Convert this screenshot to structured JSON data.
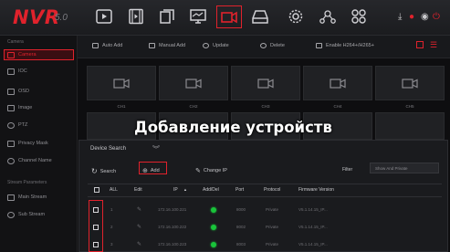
{
  "app": {
    "logo": "NVR",
    "version": "5.0"
  },
  "nav": {
    "icons": [
      "playback-icon",
      "film-icon",
      "files-icon",
      "monitor-icon",
      "camera-icon",
      "storage-icon",
      "gear-icon",
      "network-icon",
      "apps-icon"
    ],
    "active": "camera-icon",
    "right_icons": [
      "download-icon",
      "notification-icon",
      "user-icon",
      "power-icon"
    ]
  },
  "sidebar": {
    "section1": "Camera",
    "items1": [
      {
        "label": "Camera",
        "icon": "camera-icon",
        "selected": true
      },
      {
        "label": "IOC",
        "icon": "ioc-icon"
      },
      {
        "label": "OSD",
        "icon": "osd-icon"
      },
      {
        "label": "Image",
        "icon": "image-icon"
      },
      {
        "label": "PTZ",
        "icon": "ptz-icon"
      },
      {
        "label": "Privacy Mask",
        "icon": "mask-icon"
      },
      {
        "label": "Channel Name",
        "icon": "name-icon"
      }
    ],
    "section2": "Stream Parameters",
    "items2": [
      {
        "label": "Main Stream",
        "icon": "stream-icon"
      },
      {
        "label": "Sub Stream",
        "icon": "stream-icon"
      }
    ]
  },
  "toolbar": {
    "auto_add": "Auto Add",
    "manual_add": "Manual Add",
    "update": "Update",
    "delete": "Delete",
    "enable_h264": "Enable H264+/H265+"
  },
  "channels": [
    "CH1",
    "CH2",
    "CH3",
    "CH4",
    "CH5"
  ],
  "overlay_title": "Добавление устройств",
  "device_search": {
    "title": "Device Search",
    "search_label": "Search",
    "add_label": "Add",
    "change_ip_label": "Change IP",
    "filter_label": "Filter",
    "filter_value": "Show And Private",
    "columns": [
      "ALL",
      "Edit",
      "IP",
      "Add/Del",
      "Port",
      "Protocol",
      "Firmware Version"
    ],
    "rows": [
      {
        "num": "1",
        "ip": "172.16.100.221",
        "port": "8000",
        "protocol": "Private",
        "firmware": "V5.1.14.15_IP...",
        "status_color": "#19c43a"
      },
      {
        "num": "2",
        "ip": "172.16.100.222",
        "port": "8002",
        "protocol": "Private",
        "firmware": "V5.1.14.15_IP...",
        "status_color": "#19c43a"
      },
      {
        "num": "3",
        "ip": "172.16.100.223",
        "port": "8003",
        "protocol": "Private",
        "firmware": "V5.1.14.15_IP...",
        "status_color": "#19c43a"
      }
    ]
  },
  "colors": {
    "accent": "#e0222c",
    "online": "#19c43a",
    "background": "#0e0e10"
  }
}
